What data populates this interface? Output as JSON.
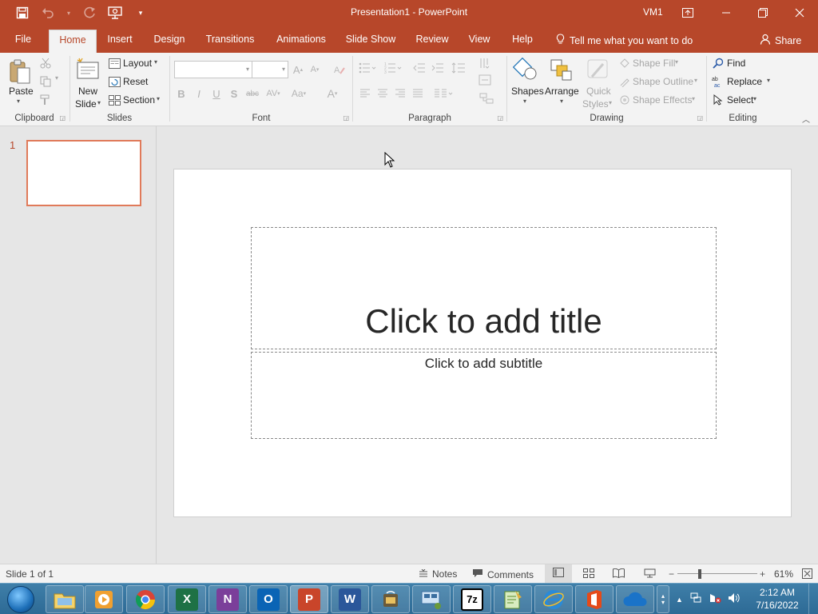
{
  "app": {
    "title": "Presentation1  -  PowerPoint",
    "user": "VM1",
    "accent": "#b7472a"
  },
  "qat": {
    "icons": [
      "save-icon",
      "undo-icon",
      "redo-icon",
      "present-icon",
      "customize-qat-icon"
    ]
  },
  "tabs": [
    "File",
    "Home",
    "Insert",
    "Design",
    "Transitions",
    "Animations",
    "Slide Show",
    "Review",
    "View",
    "Help"
  ],
  "active_tab": "Home",
  "tell_me": "Tell me what you want to do",
  "share": "Share",
  "ribbon": {
    "clipboard": {
      "paste": "Paste",
      "label": "Clipboard"
    },
    "slides": {
      "new_slide_1": "New",
      "new_slide_2": "Slide",
      "layout": "Layout",
      "reset": "Reset",
      "section": "Section",
      "label": "Slides"
    },
    "font": {
      "font_name": "",
      "font_size": "",
      "bold": "B",
      "italic": "I",
      "underline": "U",
      "shadow": "S",
      "strike": "abc",
      "label": "Font"
    },
    "paragraph": {
      "label": "Paragraph"
    },
    "drawing": {
      "shapes": "Shapes",
      "arrange": "Arrange",
      "quick": "Quick",
      "styles": "Styles",
      "shape_fill": "Shape Fill",
      "shape_outline": "Shape Outline",
      "shape_effects": "Shape Effects",
      "label": "Drawing"
    },
    "editing": {
      "find": "Find",
      "replace": "Replace",
      "select": "Select",
      "label": "Editing"
    }
  },
  "thumbnails": {
    "slide_number": "1"
  },
  "slide": {
    "title_placeholder": "Click to add title",
    "subtitle_placeholder": "Click to add subtitle"
  },
  "status": {
    "slide_info": "Slide 1 of 1",
    "notes": "Notes",
    "comments": "Comments",
    "zoom": "61%"
  },
  "taskbar": {
    "apps": [
      "file-explorer",
      "media-player",
      "chrome",
      "excel",
      "onenote",
      "outlook",
      "powerpoint",
      "word",
      "network-app",
      "remote-desktop",
      "7-zip",
      "notepad-plus",
      "internet-explorer",
      "office",
      "onedrive"
    ],
    "time": "2:12 AM",
    "date": "7/16/2022"
  }
}
